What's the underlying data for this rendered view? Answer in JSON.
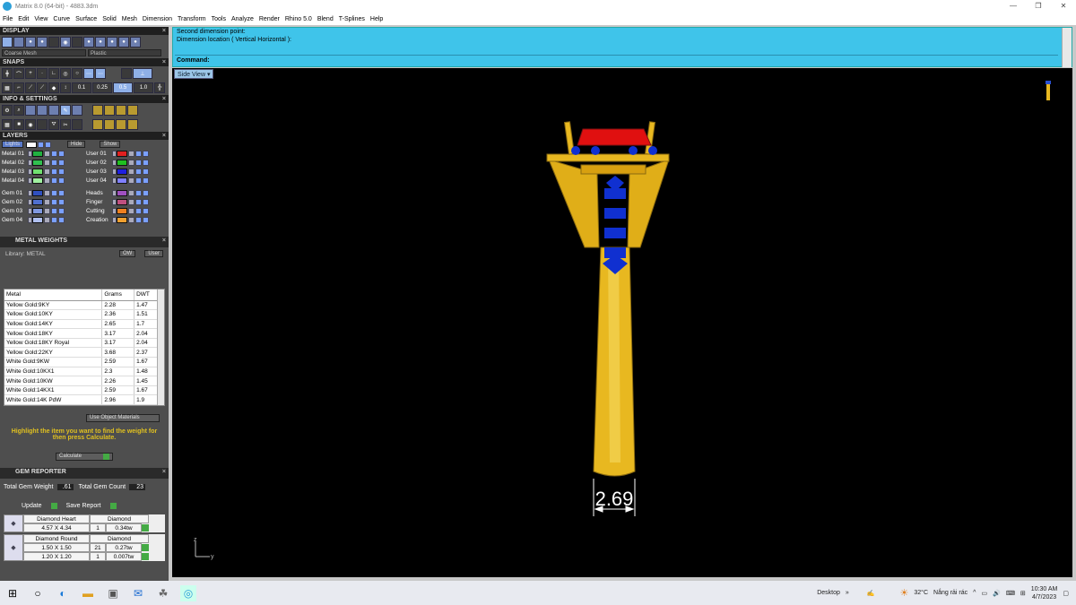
{
  "window": {
    "title": "Matrix 8.0 (64-bit) - 4883.3dm"
  },
  "menu": [
    "File",
    "Edit",
    "View",
    "Curve",
    "Surface",
    "Solid",
    "Mesh",
    "Dimension",
    "Transform",
    "Tools",
    "Analyze",
    "Render",
    "Rhino 5.0",
    "Blend",
    "T-Splines",
    "Help"
  ],
  "display": {
    "header": "DISPLAY",
    "mesh_option": "Coarse Mesh",
    "material_option": "Plastic"
  },
  "snaps": {
    "header": "SNAPS",
    "values": [
      "0.1",
      "0.25",
      "0.5",
      "1.0"
    ]
  },
  "info": {
    "header": "INFO & SETTINGS"
  },
  "layers": {
    "header": "LAYERS",
    "lights_label": "Lights",
    "hide_label": "Hide",
    "show_label": "Show",
    "left": [
      {
        "name": "Metal 01",
        "color": "#20b040"
      },
      {
        "name": "Metal 02",
        "color": "#30c050"
      },
      {
        "name": "Metal 03",
        "color": "#70e070"
      },
      {
        "name": "Metal 04",
        "color": "#a0f0a0"
      },
      {
        "name": "Gem 01",
        "color": "#3050c0"
      },
      {
        "name": "Gem 02",
        "color": "#5070d0"
      },
      {
        "name": "Gem 03",
        "color": "#8098e0"
      },
      {
        "name": "Gem 04",
        "color": "#b0c0f0"
      }
    ],
    "right": [
      {
        "name": "User 01",
        "color": "#e02020"
      },
      {
        "name": "User 02",
        "color": "#20c020"
      },
      {
        "name": "User 03",
        "color": "#2020e0"
      },
      {
        "name": "User 04",
        "color": "#8080ff"
      },
      {
        "name": "Heads",
        "color": "#a050c0"
      },
      {
        "name": "Finger",
        "color": "#c05080"
      },
      {
        "name": "Cutting",
        "color": "#f08020"
      },
      {
        "name": "Creation",
        "color": "#f0a030"
      }
    ]
  },
  "metal_weights": {
    "header": "METAL WEIGHTS",
    "library": "Library: METAL",
    "ow_label": "OW",
    "user_label": "User",
    "columns": [
      "Metal",
      "Grams",
      "DWT"
    ],
    "rows": [
      [
        "Yellow Gold:9KY",
        "2.28",
        "1.47"
      ],
      [
        "Yellow Gold:10KY",
        "2.36",
        "1.51"
      ],
      [
        "Yellow Gold:14KY",
        "2.65",
        "1.7"
      ],
      [
        "Yellow Gold:18KY",
        "3.17",
        "2.04"
      ],
      [
        "Yellow Gold:18KY Royal",
        "3.17",
        "2.04"
      ],
      [
        "Yellow Gold:22KY",
        "3.68",
        "2.37"
      ],
      [
        "White Gold:9KW",
        "2.59",
        "1.67"
      ],
      [
        "White Gold:10KX1",
        "2.3",
        "1.48"
      ],
      [
        "White Gold:10KW",
        "2.26",
        "1.45"
      ],
      [
        "White Gold:14KX1",
        "2.59",
        "1.67"
      ],
      [
        "White Gold:14K PdW",
        "2.96",
        "1.9"
      ]
    ],
    "use_object_materials": "Use Object Materials",
    "note": "Highlight the item you want to find the weight for then press Calculate.",
    "calculate": "Calculate"
  },
  "gem_reporter": {
    "header": "GEM REPORTER",
    "total_weight_label": "Total Gem Weight",
    "total_weight": ".61",
    "total_count_label": "Total Gem Count",
    "total_count": "23",
    "update": "Update",
    "save_report": "Save Report",
    "gems": [
      {
        "cut": "Diamond Heart",
        "material": "Diamond",
        "sizes": [
          {
            "size": "4.57 X 4.34",
            "count": "1",
            "weight": "0.34tw"
          }
        ]
      },
      {
        "cut": "Diamond Round",
        "material": "Diamond",
        "sizes": [
          {
            "size": "1.50 X 1.50",
            "count": "21",
            "weight": "0.27tw"
          },
          {
            "size": "1.20 X 1.20",
            "count": "1",
            "weight": "0.007tw"
          }
        ]
      }
    ]
  },
  "command": {
    "line1": "Second dimension point:",
    "line2": "Dimension location ( Vertical  Horizontal ):",
    "prompt": "Command:"
  },
  "viewport": {
    "label": "Side View",
    "dimension": "2.69",
    "axis_z": "z",
    "axis_y": "y"
  },
  "taskbar": {
    "desktop": "Desktop",
    "weather_temp": "32°C",
    "weather_text": "Nắng rải rác",
    "time": "10:30 AM",
    "date": "4/7/2023"
  },
  "colors": {
    "command_bg": "#3fc4ea",
    "panel_bg": "#4e4e4e",
    "gold": "#e8b820",
    "gem_blue": "#1030d0",
    "head_red": "#e01010"
  }
}
